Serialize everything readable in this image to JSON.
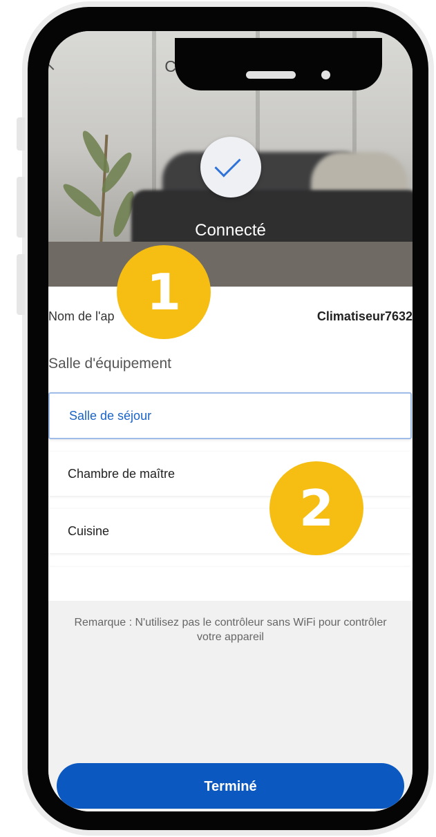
{
  "header": {
    "title": "Connexion réussie",
    "back_icon": "chevron-left-icon"
  },
  "status": {
    "icon": "checkmark-icon",
    "label": "Connecté"
  },
  "device": {
    "name_label": "Nom de l'ap",
    "name_value": "Climatiseur7632"
  },
  "rooms": {
    "title": "Salle d'équipement",
    "items": [
      {
        "label": "Salle de séjour",
        "selected": true
      },
      {
        "label": "Chambre de maître",
        "selected": false
      },
      {
        "label": "Cuisine",
        "selected": false
      },
      {
        "label": "",
        "selected": false
      }
    ]
  },
  "note": "Remarque : N'utilisez pas le contrôleur sans WiFi pour contrôler votre appareil",
  "done_button": "Terminé",
  "annotations": {
    "badge_1": "1",
    "badge_2": "2"
  },
  "colors": {
    "accent": "#0a58c0",
    "badge": "#f6be13",
    "selected_text": "#1a63c6"
  }
}
